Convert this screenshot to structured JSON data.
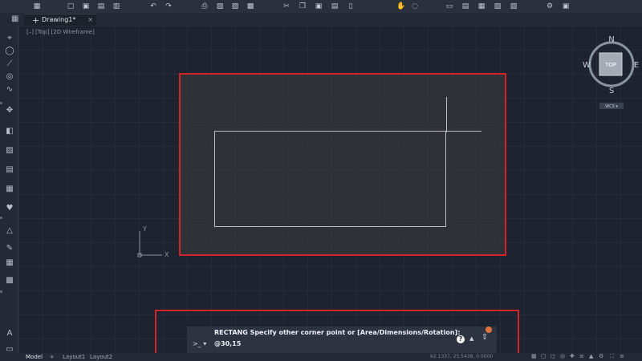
{
  "doc_tab": {
    "plus": "+",
    "name": "Drawing1*",
    "close": "×"
  },
  "view_label": "[–] [Top] [2D Wireframe]",
  "viewcube": {
    "n": "N",
    "s": "S",
    "e": "E",
    "w": "W",
    "top": "TOP",
    "wcs": "WCS ▾"
  },
  "ucs": {
    "x": "X",
    "y": "Y"
  },
  "command": {
    "prompt_text": "RECTANG Specify other corner point or [Area/Dimensions/Rotation]:",
    "input_value": "@30,15",
    "prompt_symbol": ">_ ▾",
    "help": "?",
    "expand": "▲",
    "share": "⇪"
  },
  "status": {
    "model": "Model",
    "add": "+",
    "layout1": "Layout1",
    "layout2": "Layout2",
    "coords": "62.1337, 25.5438, 0.0000"
  },
  "icons": {
    "top": [
      "grid-icon",
      "new-icon",
      "open-icon",
      "save-icon",
      "saveas-icon",
      "undo-icon",
      "redo-icon",
      "print-icon",
      "plot-icon",
      "export-icon",
      "share-icon",
      "cut-icon",
      "copy-icon",
      "paste-icon",
      "match-icon",
      "pan-icon",
      "orbit-icon",
      "zoom-icon",
      "extents-icon",
      "measure-icon",
      "layers-icon",
      "layer-props-icon",
      "blocks-icon",
      "settings-icon"
    ],
    "left": [
      "select-icon",
      "line-icon",
      "circle-icon",
      "polyline-icon",
      "arc-icon",
      "spline-icon",
      "move-icon",
      "copy-tool-icon",
      "rotate-icon",
      "scale-icon",
      "trim-icon",
      "extend-icon",
      "fillet-icon",
      "offset-icon",
      "mirror-icon",
      "array-icon",
      "hatch-icon",
      "text-icon",
      "dim-icon",
      "layer-icon"
    ]
  },
  "accent_colors": {
    "highlight": "#d0262a",
    "notification": "#e0733f"
  }
}
